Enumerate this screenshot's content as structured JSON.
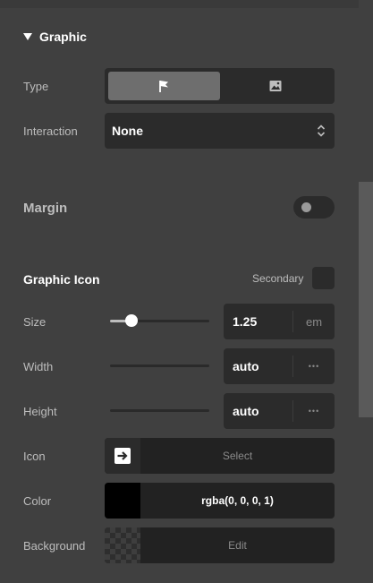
{
  "section": {
    "title": "Graphic"
  },
  "type_row": {
    "label": "Type",
    "options": [
      "flag-icon",
      "image-icon"
    ],
    "selected": "flag-icon"
  },
  "interaction_row": {
    "label": "Interaction",
    "value": "None"
  },
  "margin": {
    "label": "Margin",
    "enabled": false
  },
  "graphic_icon": {
    "title": "Graphic Icon",
    "secondary_label": "Secondary",
    "size": {
      "label": "Size",
      "value": "1.25",
      "unit": "em",
      "slider_fraction": 0.2
    },
    "width": {
      "label": "Width",
      "value": "auto",
      "more": "•••"
    },
    "height": {
      "label": "Height",
      "value": "auto",
      "more": "•••"
    },
    "icon": {
      "label": "Icon",
      "action": "Select",
      "preview_icon": "arrow-right-box-icon"
    },
    "color": {
      "label": "Color",
      "value": "rgba(0, 0, 0, 1)",
      "swatch": "#000000"
    },
    "background": {
      "label": "Background",
      "action": "Edit"
    }
  },
  "colors": {
    "panel": "#404040",
    "control": "#2b2b2b",
    "active_segment": "#6e6e6e",
    "text": "#ffffff",
    "muted": "#bdbdbd"
  }
}
